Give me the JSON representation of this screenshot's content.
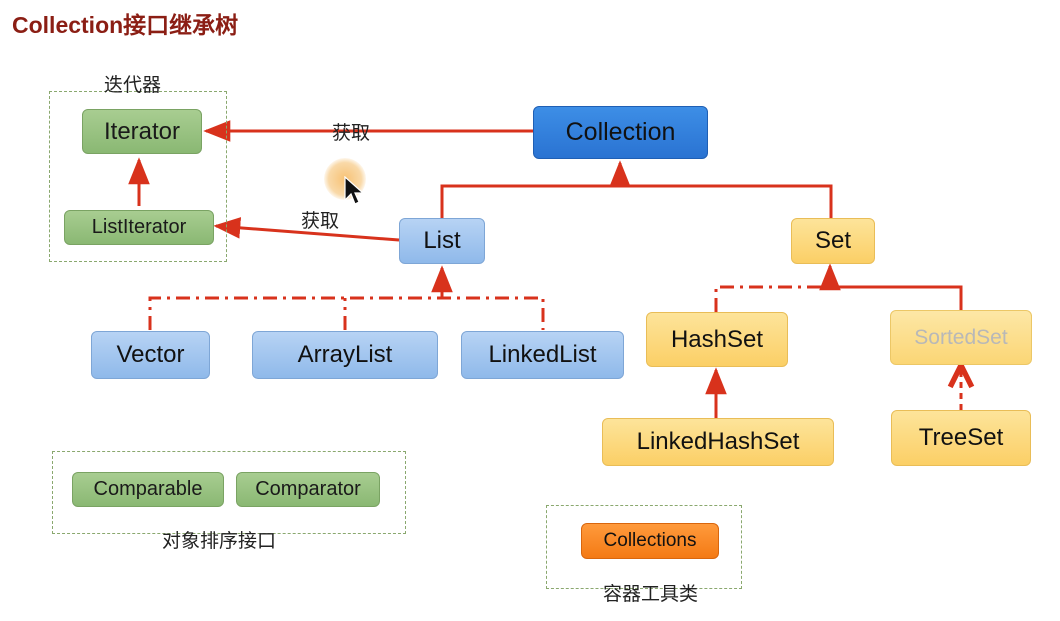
{
  "title": "Collection接口继承树",
  "groups": {
    "iterator_caption": "迭代器",
    "sort_caption": "对象排序接口",
    "tools_caption": "容器工具类"
  },
  "edge_labels": {
    "get_iterator": "获取",
    "get_listiterator": "获取"
  },
  "nodes": {
    "iterator": "Iterator",
    "listiterator": "ListIterator",
    "collection": "Collection",
    "list": "List",
    "set": "Set",
    "vector": "Vector",
    "arraylist": "ArrayList",
    "linkedlist": "LinkedList",
    "hashset": "HashSet",
    "sortedset": "SortedSet",
    "linkedhashset": "LinkedHashSet",
    "treeset": "TreeSet",
    "comparable": "Comparable",
    "comparator": "Comparator",
    "collections": "Collections"
  },
  "colors": {
    "arrow": "#d8321c",
    "interface_blue": "#2a73d2",
    "list_blue": "#9fc3ee",
    "set_orange": "#fbcf66",
    "helper_green": "#8ab873",
    "tool_orange": "#f47a14"
  }
}
